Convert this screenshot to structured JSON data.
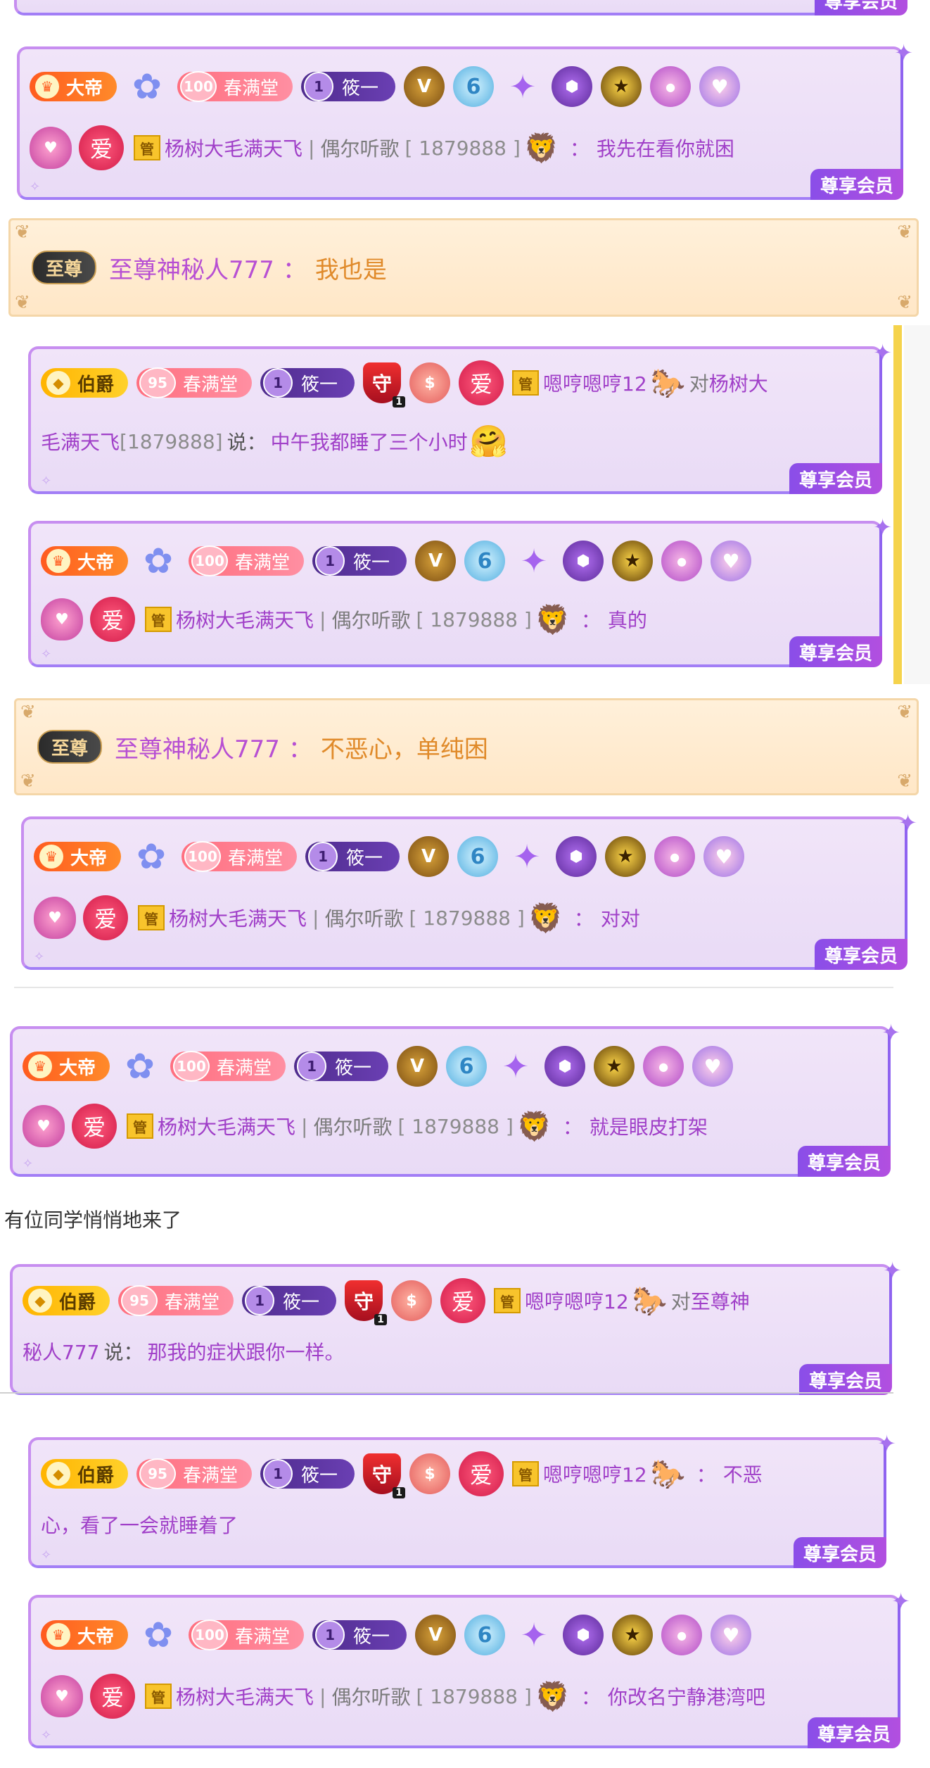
{
  "labels": {
    "vip": "尊享会员",
    "admin": "管",
    "guard_name": "筱一",
    "fan_club": "春满堂",
    "emperor": "大帝",
    "earl": "伯爵",
    "supreme_tag": "至尊",
    "love": "爱",
    "fan_level_emperor": "100",
    "fan_level_earl": "95",
    "guard_level": "1",
    "guard_badge": "守",
    "guard_badge_sub": "1"
  },
  "emperor_user": {
    "name": "杨树大毛满天飞",
    "source": "偶尔听歌",
    "id": "[ 1879888 ]"
  },
  "earl_user": {
    "name": "嗯哼嗯哼12"
  },
  "supreme_user": {
    "name": "至尊神秘人777"
  },
  "messages": {
    "m1": "我先在看你就困",
    "s1": "我也是",
    "e1": {
      "prefix": "对",
      "target_a": "杨树大",
      "target_b": "毛满天飞",
      "target_id": "[1879888]",
      "say": "说：",
      "text": "中午我都睡了三个小时"
    },
    "m2": "真的",
    "s2": "不恶心，单纯困",
    "m3": "对对",
    "m4": "就是眼皮打架",
    "joined": "有位同学悄悄地来了",
    "e2": {
      "prefix": "对",
      "target_a": "至尊神",
      "target_b": "秘人777",
      "say": "说：",
      "text": "那我的症状跟你一样。"
    },
    "e3": {
      "line1": "不恶",
      "line2": "心，看了一会就睡着了"
    },
    "m5": "你改名宁静港湾吧"
  },
  "colors": {
    "name": "#a03fc8",
    "message_supreme": "#e08a2a",
    "vip_tag": "#8a4ee8",
    "card_border": "#c78ef0"
  }
}
